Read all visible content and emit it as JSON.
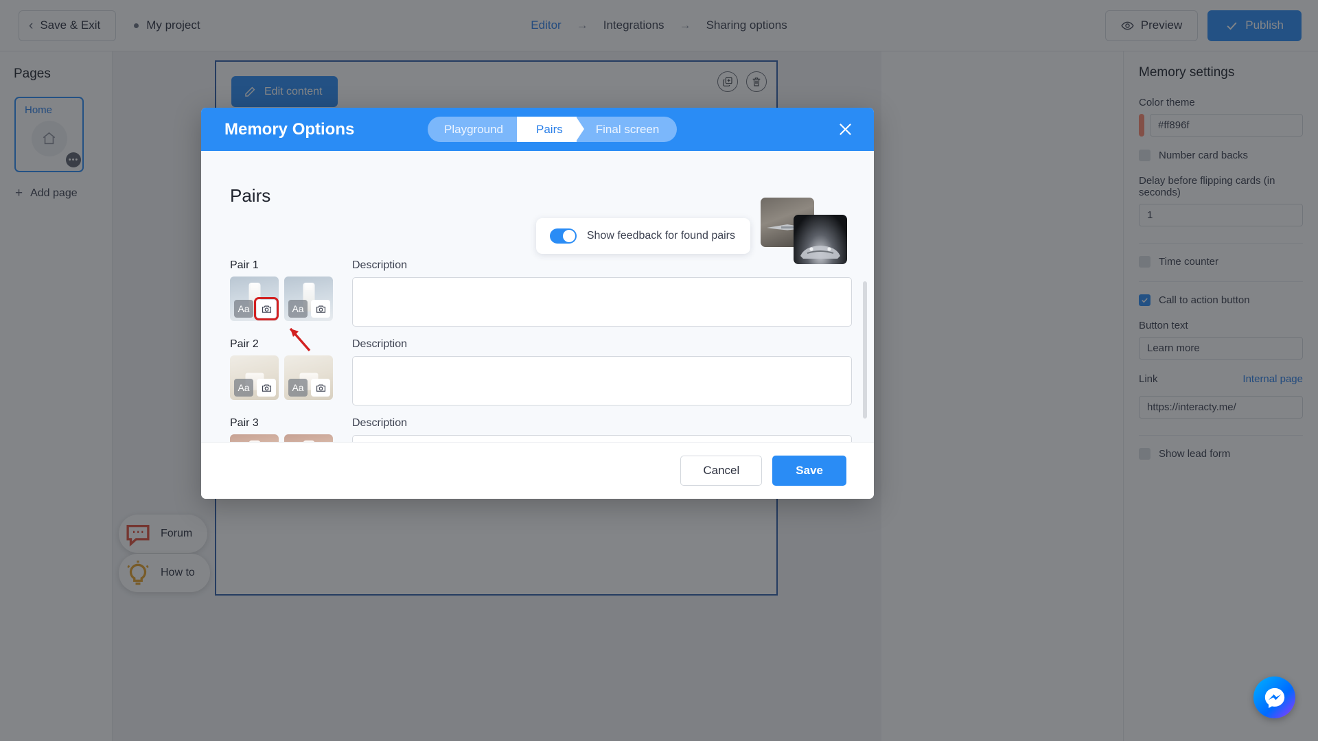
{
  "topbar": {
    "save_exit": "Save & Exit",
    "project_name": "My project",
    "steps": [
      {
        "label": "Editor",
        "active": true
      },
      {
        "label": "Integrations",
        "active": false
      },
      {
        "label": "Sharing options",
        "active": false
      }
    ],
    "arrow": "→",
    "preview": "Preview",
    "publish": "Publish"
  },
  "sidebar": {
    "title": "Pages",
    "page_card_label": "Home",
    "page_card_badge": "•••",
    "add_page": "Add page"
  },
  "canvas": {
    "edit_content": "Edit content",
    "forum": "Forum",
    "how_to": "How to"
  },
  "settings": {
    "title": "Memory settings",
    "color_theme_label": "Color theme",
    "color_theme_value": "#ff896f",
    "color_theme_swatch": "#ff896f",
    "number_card_backs": "Number card backs",
    "number_card_backs_checked": false,
    "delay_label": "Delay before flipping cards (in seconds)",
    "delay_value": "1",
    "time_counter": "Time counter",
    "time_counter_checked": false,
    "cta_label": "Call to action button",
    "cta_checked": true,
    "button_text_label": "Button text",
    "button_text_value": "Learn more",
    "link_label": "Link",
    "link_action": "Internal page",
    "link_value": "https://interacty.me/",
    "show_lead_form": "Show lead form",
    "show_lead_form_checked": false
  },
  "modal": {
    "title": "Memory Options",
    "wizard": [
      {
        "label": "Playground",
        "state": "light"
      },
      {
        "label": "Pairs",
        "state": "white"
      },
      {
        "label": "Final screen",
        "state": "light"
      }
    ],
    "section_heading": "Pairs",
    "feedback_toggle_label": "Show feedback for found pairs",
    "feedback_toggle_on": true,
    "description_label": "Description",
    "pairs": [
      {
        "label": "Pair 1",
        "description": "",
        "theme": "t1",
        "highlight_image_chip": true
      },
      {
        "label": "Pair 2",
        "description": "",
        "theme": "t2",
        "highlight_image_chip": false
      },
      {
        "label": "Pair 3",
        "description": "",
        "theme": "t3",
        "highlight_image_chip": false
      }
    ],
    "chip_text_label": "Aa",
    "cancel": "Cancel",
    "save": "Save"
  },
  "colors": {
    "accent_blue": "#2a8cf5",
    "wizard_light": "#7bb7fb",
    "theme_swatch": "#ff896f",
    "highlight_red": "#d22121"
  }
}
